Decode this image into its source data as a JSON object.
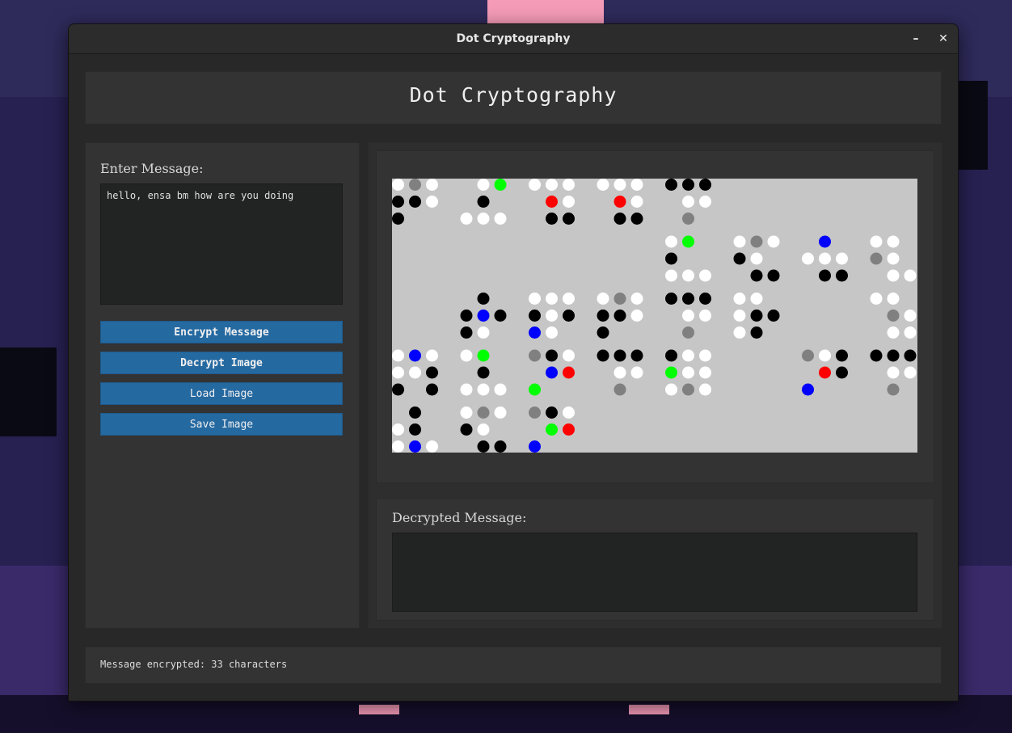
{
  "window": {
    "title": "Dot Cryptography",
    "minimize_glyph": "–",
    "close_glyph": "✕"
  },
  "header": {
    "title": "Dot Cryptography"
  },
  "input": {
    "label": "Enter Message:",
    "value": "hello, ensa bm how are you doing"
  },
  "buttons": {
    "encrypt": "Encrypt Message",
    "decrypt": "Decrypt Image",
    "load": "Load Image",
    "save": "Save Image"
  },
  "output": {
    "label": "Decrypted Message:",
    "value": ""
  },
  "status": {
    "text": "Message encrypted: 33 characters"
  },
  "colors": {
    "accent": "#2569a1",
    "canvas_bg": "#c6c6c6",
    "dot_white": "#ffffff",
    "dot_black": "#000000",
    "dot_gray": "#808080",
    "dot_red": "#ff0000",
    "dot_green": "#00ff00",
    "dot_blue": "#0000ff"
  },
  "dot_image": {
    "legend": "W=white K=black G=gray R=red L=green B=blue .=empty",
    "blocks": [
      [
        "WGW",
        "KKW",
        "K.."
      ],
      [
        ".WL",
        ".K.",
        "WWW"
      ],
      [
        "WWW",
        ".RW",
        ".KK"
      ],
      [
        "WWW",
        ".RW",
        ".KK"
      ],
      [
        "KKK",
        ".WW",
        ".G."
      ],
      [
        "...",
        "...",
        "..."
      ],
      [
        "...",
        "...",
        "..."
      ],
      [
        "...",
        "...",
        "..."
      ],
      [
        "...",
        "...",
        "..."
      ],
      [
        "...",
        "...",
        "..."
      ],
      [
        "...",
        "...",
        "..."
      ],
      [
        "...",
        "...",
        "..."
      ],
      [
        "WL.",
        "K..",
        "WWW"
      ],
      [
        "WGW",
        "KW.",
        ".KK"
      ],
      [
        ".B.",
        "WWW",
        ".KK"
      ],
      [
        "WW.",
        "GW.",
        ".WW"
      ],
      [
        "...",
        "...",
        "..."
      ],
      [
        ".K.",
        "KBK",
        "KW."
      ],
      [
        "WWW",
        "KWK",
        "BW."
      ],
      [
        "WGW",
        "KKW",
        "K.."
      ],
      [
        "KKK",
        ".WW",
        ".G."
      ],
      [
        "WW.",
        "WKK",
        "WK."
      ],
      [
        "...",
        "...",
        "..."
      ],
      [
        "WW.",
        ".GW",
        ".WW"
      ],
      [
        "WBW",
        "WWK",
        "K.K"
      ],
      [
        "WL.",
        ".K.",
        "WWW"
      ],
      [
        "GKW",
        ".BR",
        "L.."
      ],
      [
        "KKK",
        ".WW",
        ".G."
      ],
      [
        "KWW",
        "LWW",
        "WGW"
      ],
      [
        "...",
        "...",
        "..."
      ],
      [
        "GWK",
        ".RK",
        "B.."
      ],
      [
        "KKK",
        ".WW",
        ".G."
      ],
      [
        ".K.",
        "WK.",
        "WBW"
      ],
      [
        "WGW",
        "KW.",
        ".KK"
      ],
      [
        "GKW",
        ".LR",
        "B.."
      ]
    ]
  }
}
